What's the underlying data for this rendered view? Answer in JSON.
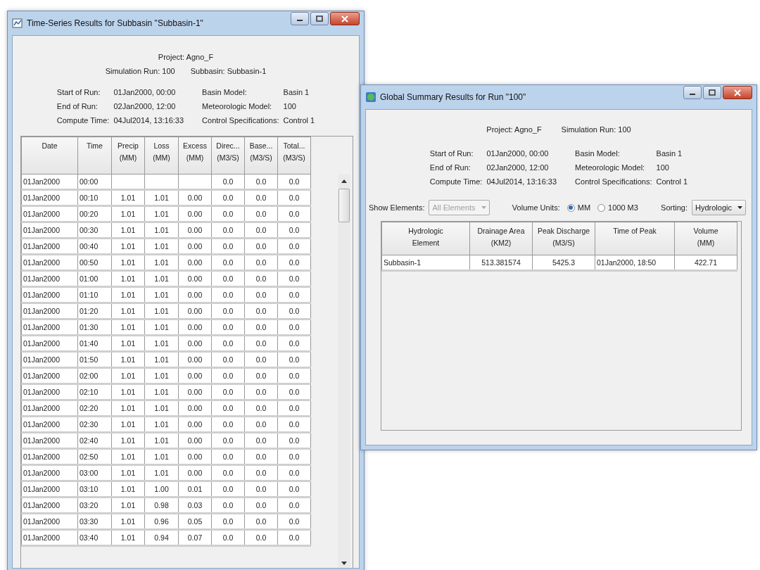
{
  "time_series_window": {
    "title": "Time-Series Results for Subbasin \"Subbasin-1\"",
    "header_lines": [
      [
        "Project: Agno_F"
      ],
      [
        "Simulation Run: 100",
        "Subbasin: Subbasin-1"
      ]
    ],
    "details_left": [
      {
        "label": "Start of Run:",
        "value": "01Jan2000, 00:00"
      },
      {
        "label": "End of Run:",
        "value": "02Jan2000, 12:00"
      },
      {
        "label": "Compute Time:",
        "value": "04Jul2014, 13:16:33"
      }
    ],
    "details_right": [
      {
        "label": "Basin Model:",
        "value": "Basin 1"
      },
      {
        "label": "Meteorologic Model:",
        "value": "100"
      },
      {
        "label": "Control Specifications:",
        "value": "Control 1"
      }
    ],
    "table": {
      "columns": [
        {
          "label": "Date"
        },
        {
          "label": "Time"
        },
        {
          "label": "Precip",
          "unit": "(MM)"
        },
        {
          "label": "Loss",
          "unit": "(MM)"
        },
        {
          "label": "Excess",
          "unit": "(MM)"
        },
        {
          "label": "Direc...",
          "unit": "(M3/S)"
        },
        {
          "label": "Base...",
          "unit": "(M3/S)"
        },
        {
          "label": "Total...",
          "unit": "(M3/S)"
        }
      ],
      "rows": [
        [
          "01Jan2000",
          "00:00",
          null,
          null,
          null,
          "0.0",
          "0.0",
          "0.0"
        ],
        [
          "01Jan2000",
          "00:10",
          "1.01",
          "1.01",
          "0.00",
          "0.0",
          "0.0",
          "0.0"
        ],
        [
          "01Jan2000",
          "00:20",
          "1.01",
          "1.01",
          "0.00",
          "0.0",
          "0.0",
          "0.0"
        ],
        [
          "01Jan2000",
          "00:30",
          "1.01",
          "1.01",
          "0.00",
          "0.0",
          "0.0",
          "0.0"
        ],
        [
          "01Jan2000",
          "00:40",
          "1.01",
          "1.01",
          "0.00",
          "0.0",
          "0.0",
          "0.0"
        ],
        [
          "01Jan2000",
          "00:50",
          "1.01",
          "1.01",
          "0.00",
          "0.0",
          "0.0",
          "0.0"
        ],
        [
          "01Jan2000",
          "01:00",
          "1.01",
          "1.01",
          "0.00",
          "0.0",
          "0.0",
          "0.0"
        ],
        [
          "01Jan2000",
          "01:10",
          "1.01",
          "1.01",
          "0.00",
          "0.0",
          "0.0",
          "0.0"
        ],
        [
          "01Jan2000",
          "01:20",
          "1.01",
          "1.01",
          "0.00",
          "0.0",
          "0.0",
          "0.0"
        ],
        [
          "01Jan2000",
          "01:30",
          "1.01",
          "1.01",
          "0.00",
          "0.0",
          "0.0",
          "0.0"
        ],
        [
          "01Jan2000",
          "01:40",
          "1.01",
          "1.01",
          "0.00",
          "0.0",
          "0.0",
          "0.0"
        ],
        [
          "01Jan2000",
          "01:50",
          "1.01",
          "1.01",
          "0.00",
          "0.0",
          "0.0",
          "0.0"
        ],
        [
          "01Jan2000",
          "02:00",
          "1.01",
          "1.01",
          "0.00",
          "0.0",
          "0.0",
          "0.0"
        ],
        [
          "01Jan2000",
          "02:10",
          "1.01",
          "1.01",
          "0.00",
          "0.0",
          "0.0",
          "0.0"
        ],
        [
          "01Jan2000",
          "02:20",
          "1.01",
          "1.01",
          "0.00",
          "0.0",
          "0.0",
          "0.0"
        ],
        [
          "01Jan2000",
          "02:30",
          "1.01",
          "1.01",
          "0.00",
          "0.0",
          "0.0",
          "0.0"
        ],
        [
          "01Jan2000",
          "02:40",
          "1.01",
          "1.01",
          "0.00",
          "0.0",
          "0.0",
          "0.0"
        ],
        [
          "01Jan2000",
          "02:50",
          "1.01",
          "1.01",
          "0.00",
          "0.0",
          "0.0",
          "0.0"
        ],
        [
          "01Jan2000",
          "03:00",
          "1.01",
          "1.01",
          "0.00",
          "0.0",
          "0.0",
          "0.0"
        ],
        [
          "01Jan2000",
          "03:10",
          "1.01",
          "1.00",
          "0.01",
          "0.0",
          "0.0",
          "0.0"
        ],
        [
          "01Jan2000",
          "03:20",
          "1.01",
          "0.98",
          "0.03",
          "0.0",
          "0.0",
          "0.0"
        ],
        [
          "01Jan2000",
          "03:30",
          "1.01",
          "0.96",
          "0.05",
          "0.0",
          "0.0",
          "0.0"
        ],
        [
          "01Jan2000",
          "03:40",
          "1.01",
          "0.94",
          "0.07",
          "0.0",
          "0.0",
          "0.0"
        ]
      ]
    }
  },
  "summary_window": {
    "title": "Global Summary Results for Run \"100\"",
    "header_lines": [
      [
        "Project: Agno_F",
        "Simulation Run: 100"
      ]
    ],
    "details_left": [
      {
        "label": "Start of Run:",
        "value": "01Jan2000, 00:00"
      },
      {
        "label": "End of Run:",
        "value": "02Jan2000, 12:00"
      },
      {
        "label": "Compute Time:",
        "value": "04Jul2014, 13:16:33"
      }
    ],
    "details_right": [
      {
        "label": "Basin Model:",
        "value": "Basin 1"
      },
      {
        "label": "Meteorologic Model:",
        "value": "100"
      },
      {
        "label": "Control Specifications:",
        "value": "Control 1"
      }
    ],
    "show_elements": {
      "label": "Show Elements:",
      "value": "All Elements",
      "disabled": true
    },
    "volume_units": {
      "label": "Volume Units:",
      "options": [
        {
          "label": "MM",
          "selected": true
        },
        {
          "label": "1000 M3",
          "selected": false
        }
      ]
    },
    "sorting": {
      "label": "Sorting:",
      "value": "Hydrologic",
      "disabled": false
    },
    "table": {
      "columns": [
        {
          "label": "Hydrologic",
          "unit": "Element"
        },
        {
          "label": "Drainage Area",
          "unit": "(KM2)"
        },
        {
          "label": "Peak Discharge",
          "unit": "(M3/S)"
        },
        {
          "label": "Time of Peak"
        },
        {
          "label": "Volume",
          "unit": "(MM)"
        }
      ],
      "rows": [
        [
          "Subbasin-1",
          "513.381574",
          "5425.3",
          "01Jan2000, 18:50",
          "422.71"
        ]
      ]
    }
  }
}
